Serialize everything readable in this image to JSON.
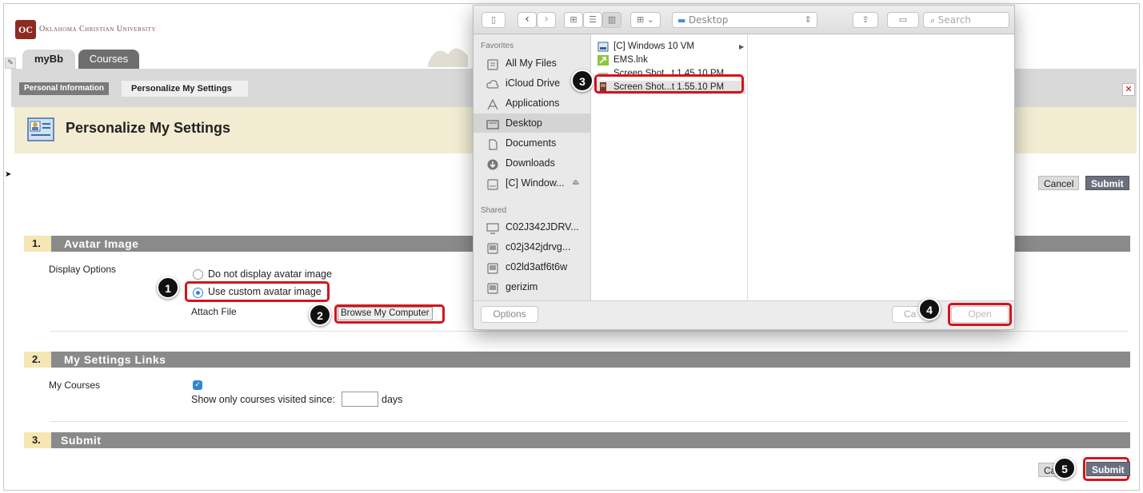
{
  "university": {
    "name": "Oklahoma Christian University",
    "logo": "OC"
  },
  "tabs": [
    {
      "label": "myBb"
    },
    {
      "label": "Courses"
    }
  ],
  "breadcrumb": {
    "parent": "Personal Information",
    "current": "Personalize My Settings"
  },
  "page": {
    "title": "Personalize My Settings"
  },
  "actions": {
    "cancel": "Cancel",
    "submit": "Submit",
    "cancel_partial": "Ca"
  },
  "sections": [
    {
      "number": "1.",
      "title": "Avatar Image"
    },
    {
      "number": "2.",
      "title": "My Settings Links"
    },
    {
      "number": "3.",
      "title": "Submit"
    }
  ],
  "avatar": {
    "label": "Display Options",
    "option_none": "Do not display avatar image",
    "option_custom": "Use custom avatar image",
    "selected": "custom",
    "attach_label": "Attach File",
    "browse_button": "Browse My Computer"
  },
  "links": {
    "label": "My Courses",
    "checked": true,
    "visited_prefix": "Show only courses visited since:",
    "visited_value": "",
    "visited_suffix": "days"
  },
  "dialog": {
    "location": "Desktop",
    "search_placeholder": "Search",
    "favorites_header": "Favorites",
    "favorites": [
      {
        "label": "All My Files",
        "icon": "all-files-icon"
      },
      {
        "label": "iCloud Drive",
        "icon": "cloud-icon"
      },
      {
        "label": "Applications",
        "icon": "applications-icon"
      },
      {
        "label": "Desktop",
        "icon": "desktop-icon",
        "selected": true
      },
      {
        "label": "Documents",
        "icon": "documents-icon"
      },
      {
        "label": "Downloads",
        "icon": "downloads-icon"
      },
      {
        "label": "[C] Window...",
        "icon": "drive-icon"
      }
    ],
    "shared_header": "Shared",
    "shared": [
      {
        "label": "C02J342JDRV...",
        "icon": "computer-icon"
      },
      {
        "label": "c02j342jdrvg...",
        "icon": "computer-icon"
      },
      {
        "label": "c02ld3atf6t6w",
        "icon": "computer-icon"
      },
      {
        "label": "gerizim",
        "icon": "computer-icon"
      }
    ],
    "files": [
      {
        "label": "[C] Windows 10 VM",
        "icon": "drive-icon"
      },
      {
        "label": "EMS.lnk",
        "icon": "shortcut-icon"
      },
      {
        "label": "Screen Shot...t 1.45.10 PM",
        "icon": "image-file-icon"
      },
      {
        "label": "Screen Shot...t 1.55.10 PM",
        "icon": "image-file-icon",
        "selected": true
      }
    ],
    "options_button": "Options",
    "cancel_partial": "Ca",
    "open_button": "Open"
  },
  "callouts": [
    "1",
    "2",
    "3",
    "4",
    "5"
  ],
  "colors": {
    "highlight": "#d7131b",
    "section_bar": "#8a8a8a",
    "header_bg": "#f1ecd2",
    "submit": "#6b6f80"
  }
}
